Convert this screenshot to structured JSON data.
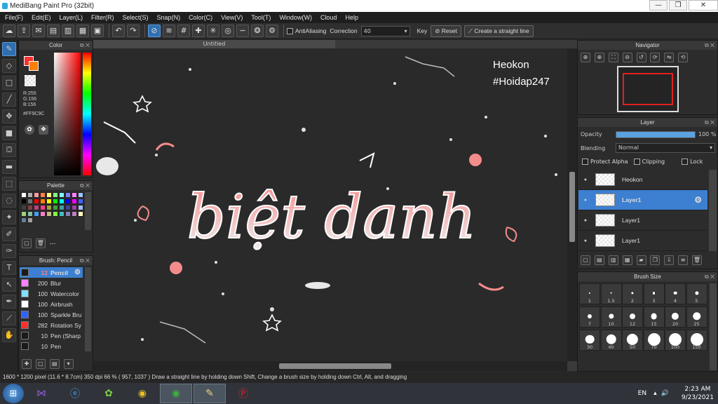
{
  "window": {
    "title": "MediBang Paint Pro (32bit)",
    "min": "—",
    "max": "❐",
    "close": "✕"
  },
  "menu": [
    "File(F)",
    "Edit(E)",
    "Layer(L)",
    "Filter(R)",
    "Select(S)",
    "Snap(N)",
    "Color(C)",
    "View(V)",
    "Tool(T)",
    "Window(W)",
    "Cloud",
    "Help"
  ],
  "toolbar": {
    "antialiasing": "AntiAliasing",
    "correction_label": "Correction",
    "correction_value": "40",
    "key_label": "Key",
    "reset_label": "Reset",
    "straight_line_label": "Create a straight line"
  },
  "canvas": {
    "doc_title": "Untitled",
    "watermark_line1": "Heokon",
    "watermark_line2": "#Hoidap247",
    "art_text": "biệt danh"
  },
  "color_panel": {
    "title": "Color",
    "r": "R:255",
    "g": "G:156",
    "b": "B:156",
    "hex": "#FF9C9C",
    "primary_color": "#ff5a5a",
    "secondary_color": "#ffffff"
  },
  "palette_panel": {
    "title": "Palette",
    "more": "---",
    "colors": [
      "#ffffff",
      "#b0b0b0",
      "#ff9c9c",
      "#ff8040",
      "#ffff80",
      "#80ff80",
      "#80ffff",
      "#8080ff",
      "#ff80ff",
      "#9ac5ff",
      "#000000",
      "#707070",
      "#ff0000",
      "#ff8000",
      "#ffff00",
      "#00ff00",
      "#00ffff",
      "#0000ff",
      "#ff00ff",
      "#4060ff",
      "#404040",
      "#804040",
      "#c04080",
      "#ff4080",
      "#a0a040",
      "#40a040",
      "#40a0a0",
      "#4040a0",
      "#a040a0",
      "#a0c0ff",
      "#a0d080",
      "#80c0a0",
      "#40a0ff",
      "#ff80c0",
      "#c0c080",
      "#80ff40",
      "#40c0c0",
      "#8080c0",
      "#c080c0",
      "#ffffc0",
      "#6080a0",
      "#a0a0a0"
    ]
  },
  "brush_panel": {
    "title": "Brush: Pencil",
    "items": [
      {
        "size": "12",
        "name": "Pencil",
        "color": "#1a1a1a",
        "selected": true
      },
      {
        "size": "200",
        "name": "Blur",
        "color": "#ff80ff",
        "selected": false
      },
      {
        "size": "100",
        "name": "Watercolor",
        "color": "#80e0ff",
        "selected": false
      },
      {
        "size": "100",
        "name": "Airbrush",
        "color": "#ffffff",
        "selected": false
      },
      {
        "size": "100",
        "name": "Sparkle Bru",
        "color": "#3060ff",
        "selected": false
      },
      {
        "size": "282",
        "name": "Rotation Sy",
        "color": "#ff3030",
        "selected": false
      },
      {
        "size": "10",
        "name": "Pen (Sharp",
        "color": "#1a1a1a",
        "selected": false
      },
      {
        "size": "10",
        "name": "Pen",
        "color": "#1a1a1a",
        "selected": false
      }
    ]
  },
  "navigator": {
    "title": "Navigator"
  },
  "layer_panel": {
    "title": "Layer",
    "opacity_label": "Opacity",
    "opacity_value": "100 %",
    "opacity_fraction": 1.0,
    "blending_label": "Blending",
    "blending_value": "Normal",
    "protect_alpha": "Protect Alpha",
    "clipping": "Clipping",
    "lock": "Lock",
    "layers": [
      {
        "name": "Heokon",
        "selected": false
      },
      {
        "name": "Layer1",
        "selected": true
      },
      {
        "name": "Layer1",
        "selected": false
      },
      {
        "name": "Layer1",
        "selected": false
      }
    ]
  },
  "brush_size": {
    "title": "Brush Size",
    "sizes": [
      "1",
      "1.5",
      "2",
      "3",
      "4",
      "5",
      "7",
      "10",
      "12",
      "15",
      "20",
      "25",
      "30",
      "40",
      "50",
      "70",
      "100",
      "150"
    ]
  },
  "status": "1600 * 1200 pixel   (11.6 * 8.7cm)   350 dpi   66 %   ( 957, 1037 )   Draw a straight line by holding down Shift, Change a brush size by holding down Ctrl, Alt, and dragging",
  "taskbar": {
    "lang": "EN",
    "time": "2:23 AM",
    "date": "9/23/2021"
  }
}
